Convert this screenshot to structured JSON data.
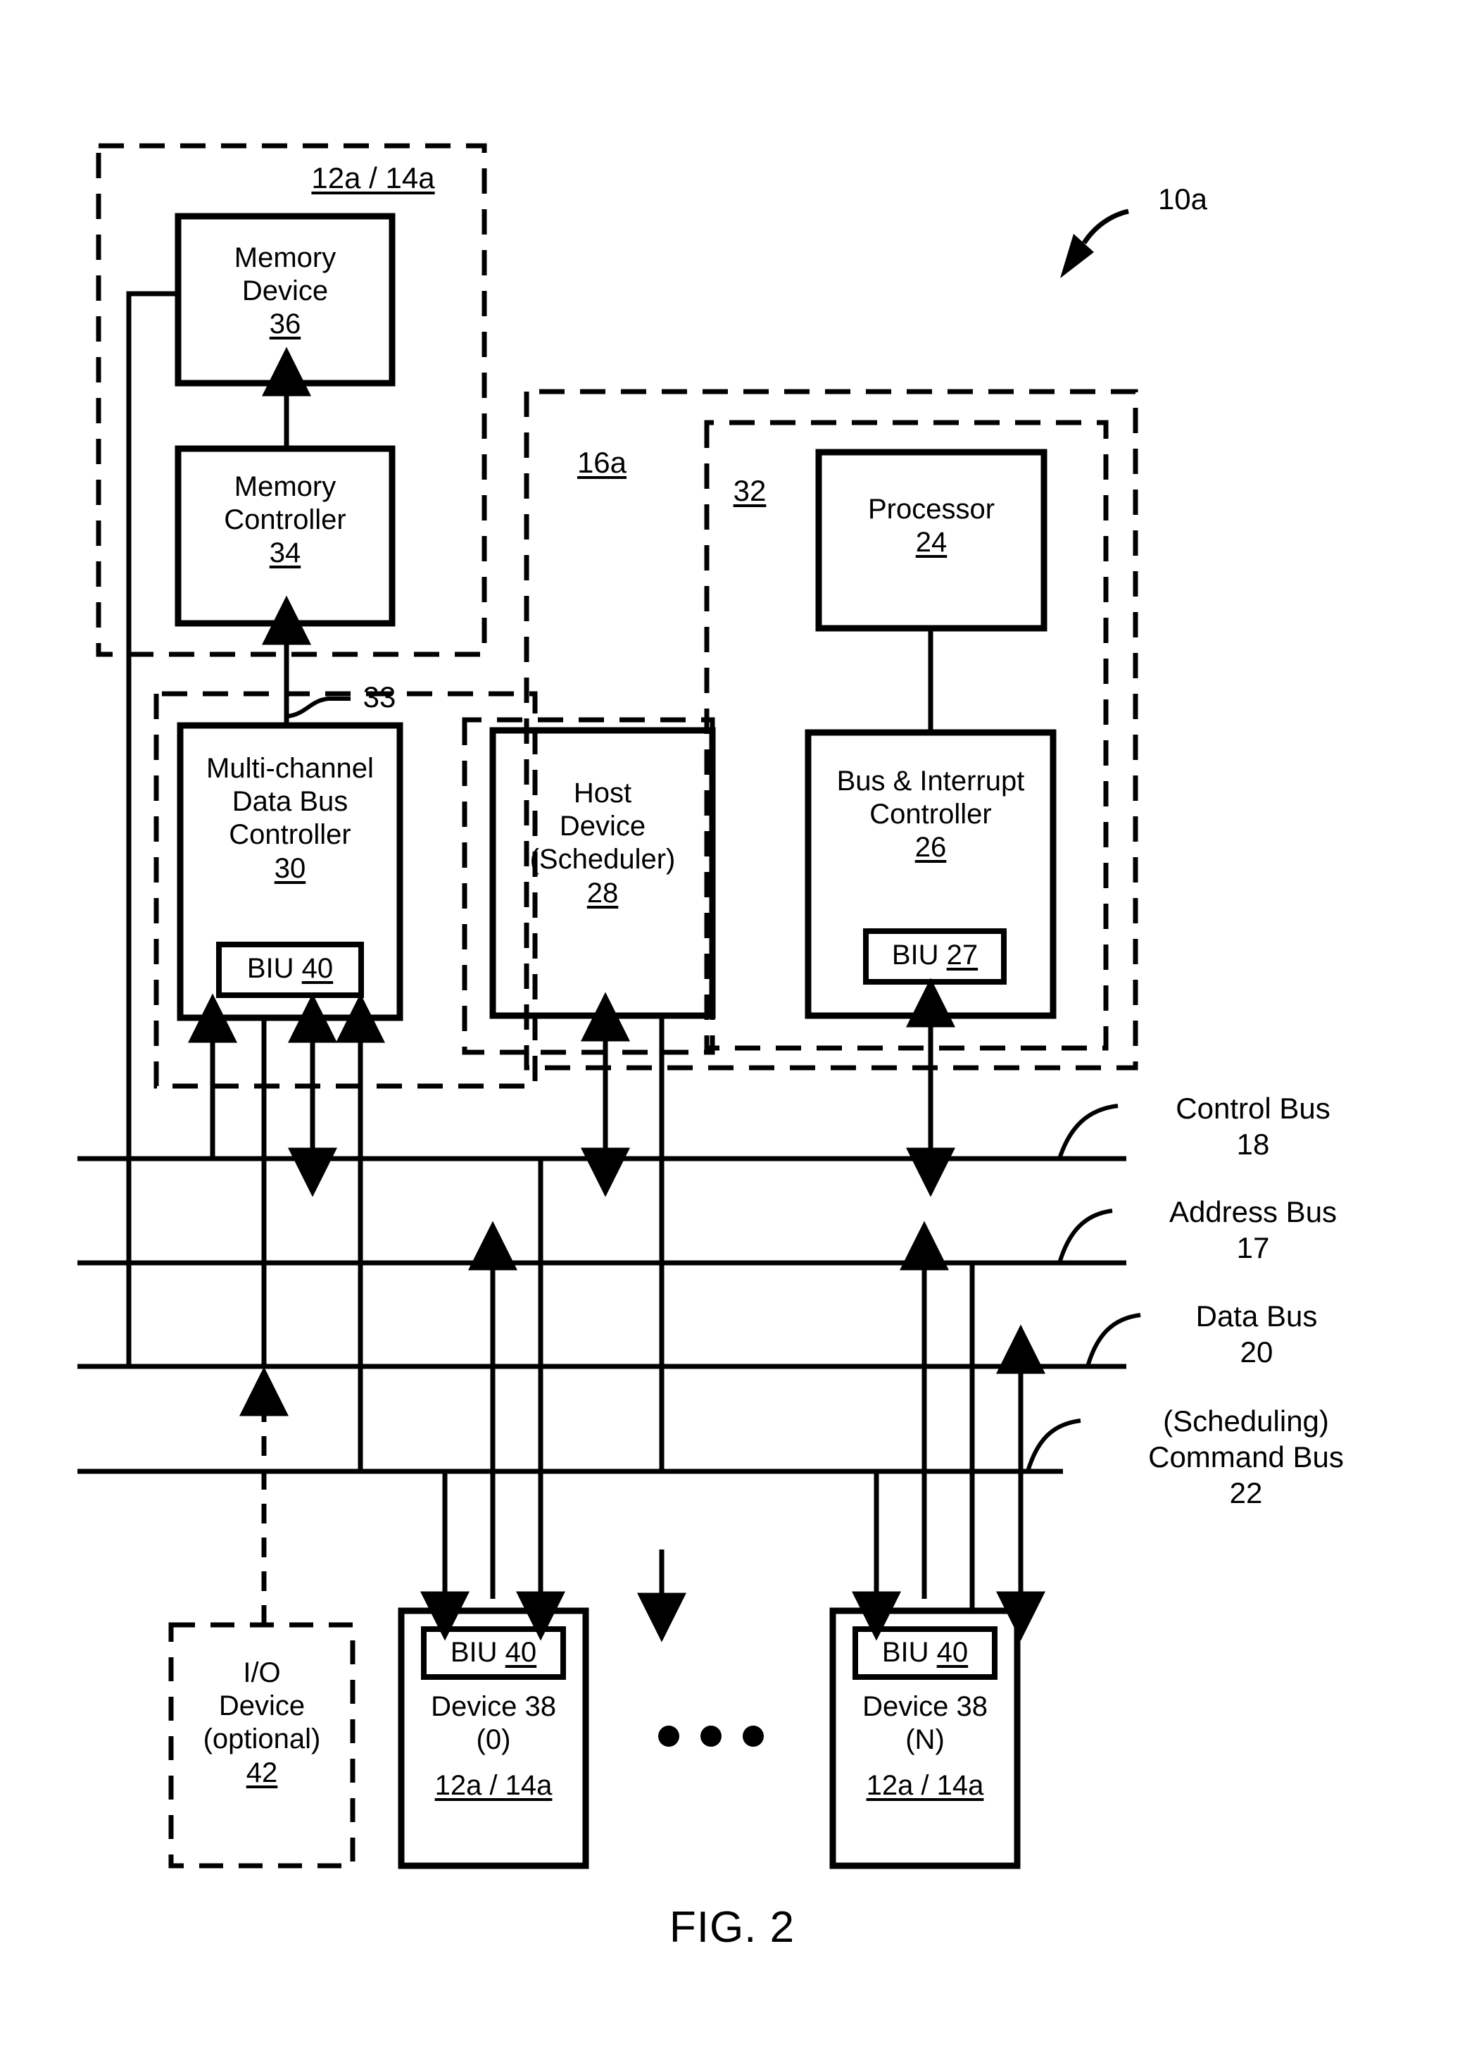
{
  "figure": {
    "caption": "FIG. 2",
    "system_ref": "10a"
  },
  "groups": {
    "memory_subsystem_ref": "12a / 14a",
    "host_group_ref": "16a",
    "processor_group_ref": "32",
    "link_ref": "33"
  },
  "blocks": {
    "memory_device": {
      "line1": "Memory",
      "line2": "Device",
      "ref": "36"
    },
    "memory_controller": {
      "line1": "Memory",
      "line2": "Controller",
      "ref": "34"
    },
    "mdbc": {
      "line1": "Multi-channel",
      "line2": "Data Bus",
      "line3": "Controller",
      "ref": "30",
      "biu": "BIU",
      "biu_ref": "40"
    },
    "host_device": {
      "line1": "Host",
      "line2": "Device",
      "line3": "(Scheduler)",
      "ref": "28"
    },
    "processor": {
      "line1": "Processor",
      "ref": "24"
    },
    "bus_interrupt_controller": {
      "line1": "Bus & Interrupt",
      "line2": "Controller",
      "ref": "26",
      "biu": "BIU",
      "biu_ref": "27"
    },
    "io_device": {
      "line1": "I/O",
      "line2": "Device",
      "line3": "(optional)",
      "ref": "42"
    },
    "device_0": {
      "biu": "BIU",
      "biu_ref": "40",
      "line1": "Device 38",
      "line2": "(0)",
      "ref": "12a / 14a"
    },
    "device_n": {
      "biu": "BIU",
      "biu_ref": "40",
      "line1": "Device 38",
      "line2": "(N)",
      "ref": "12a / 14a"
    },
    "device_ellipsis": "• • •"
  },
  "buses": [
    {
      "name": "Control Bus",
      "ref": "18"
    },
    {
      "name": "Address Bus",
      "ref": "17"
    },
    {
      "name": "Data Bus",
      "ref": "20"
    },
    {
      "name": "(Scheduling)",
      "name2": "Command Bus",
      "ref": "22"
    }
  ],
  "colors": {
    "ink": "#000000",
    "paper": "#ffffff"
  }
}
